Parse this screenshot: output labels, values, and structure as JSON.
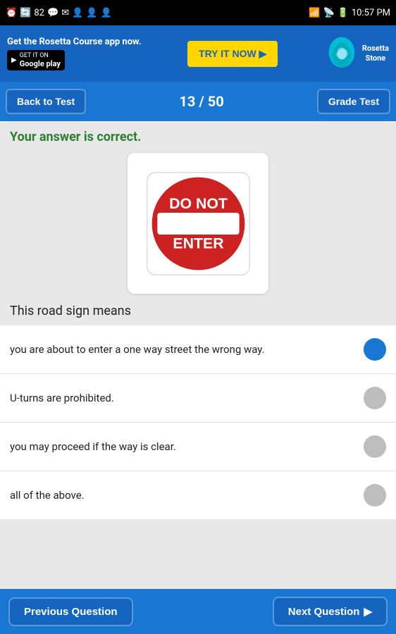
{
  "statusBar": {
    "time": "10:57 PM",
    "battery": "82",
    "icons": [
      "alarm",
      "sync",
      "message",
      "email",
      "person",
      "person",
      "person",
      "wifi",
      "signal",
      "battery"
    ]
  },
  "adBanner": {
    "title": "Get the Rosetta Course app now.",
    "googlePlay": "GET IT ON",
    "googlePlayStore": "Google play",
    "tryBtn": "TRY IT NOW ▶",
    "rosettaText": "Rosetta\nStone"
  },
  "navBar": {
    "backLabel": "Back to Test",
    "counter": "13 / 50",
    "gradeLabel": "Grade Test"
  },
  "answerStatus": "Your answer is correct.",
  "questionText": "This road sign means",
  "options": [
    {
      "id": 1,
      "text": "you are about to enter a one way street the wrong way.",
      "selected": true
    },
    {
      "id": 2,
      "text": "U-turns are prohibited.",
      "selected": false
    },
    {
      "id": 3,
      "text": "you may proceed if the way is clear.",
      "selected": false
    },
    {
      "id": 4,
      "text": "all of the above.",
      "selected": false
    }
  ],
  "bottomNav": {
    "prevLabel": "Previous Question",
    "nextLabel": "Next Question"
  }
}
